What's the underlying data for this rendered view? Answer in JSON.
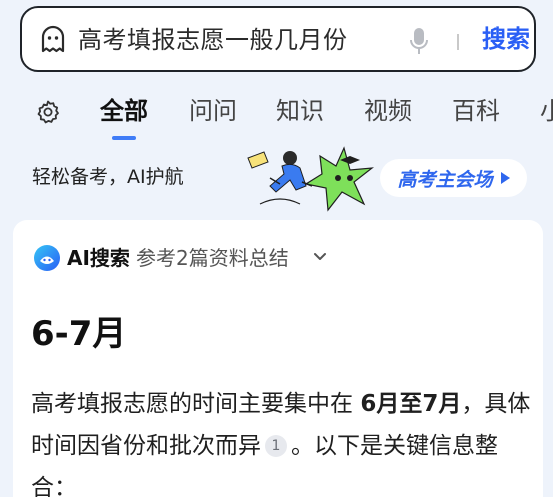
{
  "search": {
    "query": "高考填报志愿一般几月份",
    "button_label": "搜索"
  },
  "tabs": [
    {
      "label": "全部"
    },
    {
      "label": "问问"
    },
    {
      "label": "知识"
    },
    {
      "label": "视频"
    },
    {
      "label": "百科"
    },
    {
      "label": "小"
    }
  ],
  "promo": {
    "text": "轻松备考，AI护航",
    "pill_label": "高考主会场"
  },
  "answer": {
    "source_label": "AI搜索",
    "source_sub": "参考2篇资料总结",
    "headline": "6-7月",
    "body_part1": "高考填报志愿的时间主要集中在 ",
    "body_bold": "6月至7月",
    "body_part2": "，具体时间因省份和批次而异",
    "citation": "1",
    "body_part3": "。以下是关键信息整合："
  },
  "colors": {
    "accent": "#2a5ff5",
    "background": "#eef3fb"
  }
}
